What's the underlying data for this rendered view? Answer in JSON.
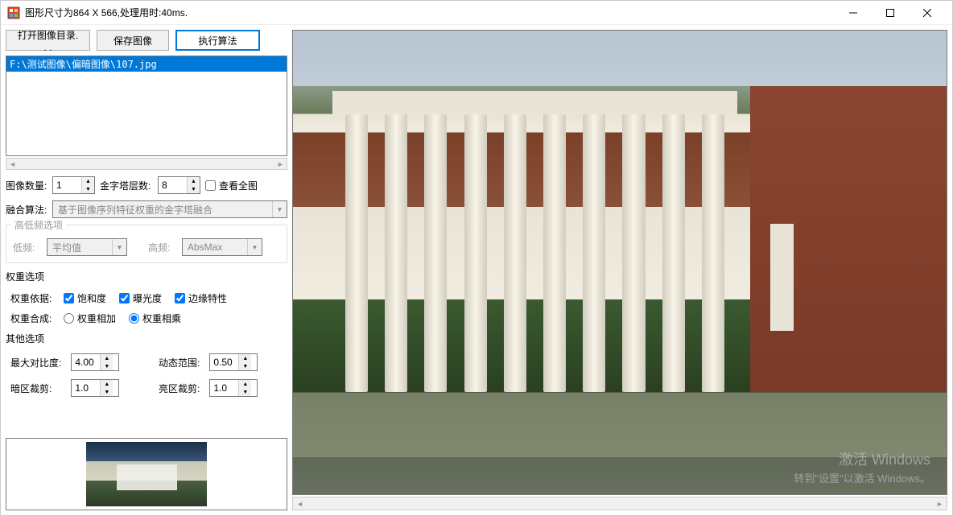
{
  "window": {
    "title": "图形尺寸为864 X 566,处理用时:40ms."
  },
  "toolbar": {
    "open_dir": "打开图像目录. . .",
    "save_image": "保存图像",
    "run_algorithm": "执行算法"
  },
  "file_list": {
    "selected": "F:\\测试图像\\偏暗图像\\107.jpg"
  },
  "params": {
    "image_count_label": "图像数量:",
    "image_count": "1",
    "pyramid_levels_label": "金字塔层数:",
    "pyramid_levels": "8",
    "view_full_label": "查看全图"
  },
  "fusion": {
    "label": "融合算法:",
    "value": "基于图像序列特征权重的金字塔融合"
  },
  "highlow": {
    "title": "高低频选项",
    "low_label": "低频:",
    "low_value": "平均值",
    "high_label": "高频:",
    "high_value": "AbsMax"
  },
  "weight": {
    "title": "权重选项",
    "basis_label": "权重依据:",
    "saturation": "饱和度",
    "exposure": "曝光度",
    "edge": "边缘特性",
    "compose_label": "权重合成:",
    "add": "权重相加",
    "mul": "权重相乘"
  },
  "other": {
    "title": "其他选项",
    "max_contrast_label": "最大对比度:",
    "max_contrast": "4.00",
    "dynamic_range_label": "动态范围:",
    "dynamic_range": "0.50",
    "dark_clip_label": "暗区裁剪:",
    "dark_clip": "1.0",
    "light_clip_label": "亮区裁剪:",
    "light_clip": "1.0"
  },
  "watermark": {
    "line1": "激活 Windows",
    "line2": "转到\"设置\"以激活 Windows。"
  }
}
